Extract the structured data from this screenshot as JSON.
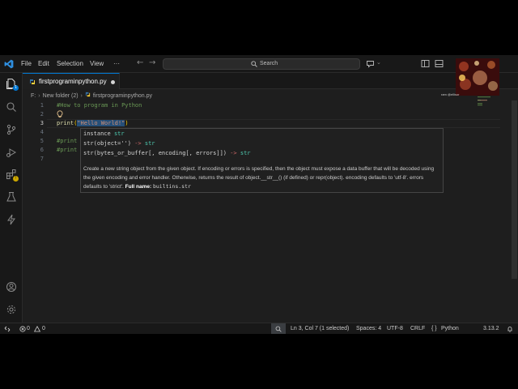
{
  "menu": [
    "File",
    "Edit",
    "Selection",
    "View",
    "···"
  ],
  "search": {
    "placeholder": "Search"
  },
  "tab": {
    "label": "firstprograminpython.py",
    "modified": true
  },
  "breadcrumb": {
    "drive": "F:",
    "folder": "New folder (2)",
    "file": "firstprograminpython.py"
  },
  "editor": {
    "line_numbers": [
      "1",
      "2",
      "3",
      "4",
      "5",
      "6",
      "7"
    ],
    "active_line": "3",
    "lines": {
      "l1": "#How to program in Python",
      "l3_fn": "print",
      "l3_open": "(",
      "l3_str": "\"Hello World!\"",
      "l3_close": ")",
      "l5": "#print",
      "l6": "#print"
    }
  },
  "hover": {
    "sig1_a": "instance ",
    "sig1_b": "str",
    "sig2_a": "str(object='') ",
    "sig2_arrow": "->",
    "sig2_b": " str",
    "sig3_a": "str(bytes_or_buffer[, encoding[, errors]]) ",
    "sig3_arrow": "->",
    "sig3_b": " str",
    "doc": "Create a new string object from the given object. If encoding or errors is specified, then the object must expose a data buffer that will be decoded using the given encoding and error handler. Otherwise, returns the result of object.__str__() (if defined) or repr(object). encoding defaults to 'utf-8'. errors defaults to 'strict'.",
    "full_name_label": "Full name:",
    "full_name": "builtins.str"
  },
  "webcam": {
    "caption": "ram @ellisor"
  },
  "status": {
    "errors": "0",
    "warnings": "0",
    "position": "Ln 3, Col 7 (1 selected)",
    "spaces": "Spaces: 4",
    "encoding": "UTF-8",
    "eol": "CRLF",
    "language_braces": "{ }",
    "language": "Python",
    "version": "3.13.2"
  },
  "colors": {
    "accent": "#0078d4",
    "comment": "#6a9955",
    "string": "#ce9178",
    "function": "#dcdcaa",
    "bracket": "#ffd700"
  }
}
